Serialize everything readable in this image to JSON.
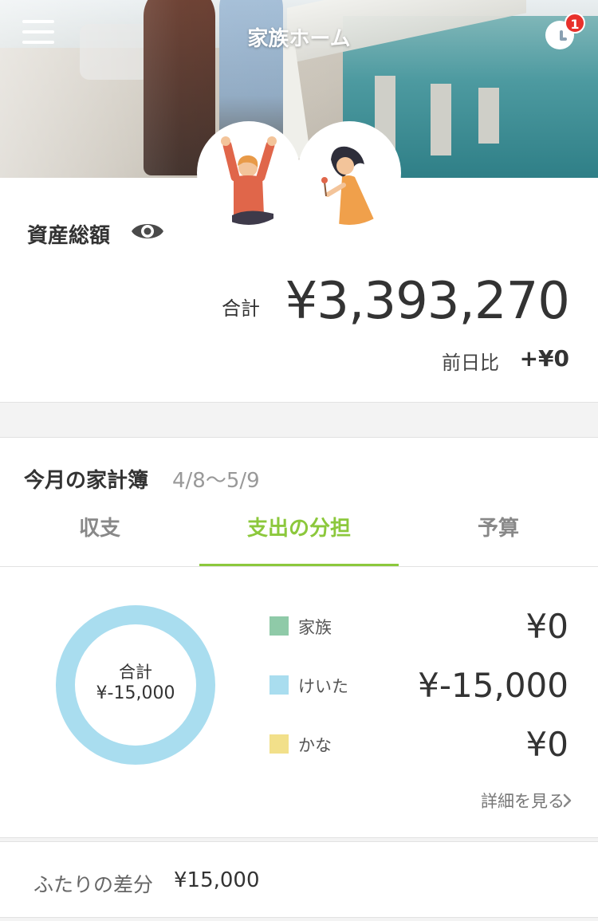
{
  "nav": {
    "title": "家族ホーム",
    "notification_count": "1"
  },
  "assets": {
    "label": "資産総額",
    "total_prefix": "合計",
    "total_value": "¥3,393,270",
    "diff_label": "前日比",
    "diff_value": "+¥0"
  },
  "household": {
    "title": "今月の家計簿",
    "period": "4/8〜5/9",
    "tabs": [
      {
        "label": "収支",
        "active": false
      },
      {
        "label": "支出の分担",
        "active": true
      },
      {
        "label": "予算",
        "active": false
      }
    ],
    "donut": {
      "label": "合計",
      "value": "¥-15,000"
    },
    "legend": [
      {
        "name": "家族",
        "amount": "¥0",
        "color": "#8fcaa8"
      },
      {
        "name": "けいた",
        "amount": "¥-15,000",
        "color": "#a9ddef"
      },
      {
        "name": "かな",
        "amount": "¥0",
        "color": "#f2e08a"
      }
    ],
    "detail_link": "詳細を見る"
  },
  "pair_diff": {
    "label": "ふたりの差分",
    "value": "¥15,000"
  },
  "colors": {
    "accent": "#8cc83c",
    "badge": "#e8312b",
    "donut_ring": "#a9ddef"
  },
  "icons": [
    "menu-icon",
    "history-icon",
    "eye-icon",
    "chevron-right-icon"
  ]
}
